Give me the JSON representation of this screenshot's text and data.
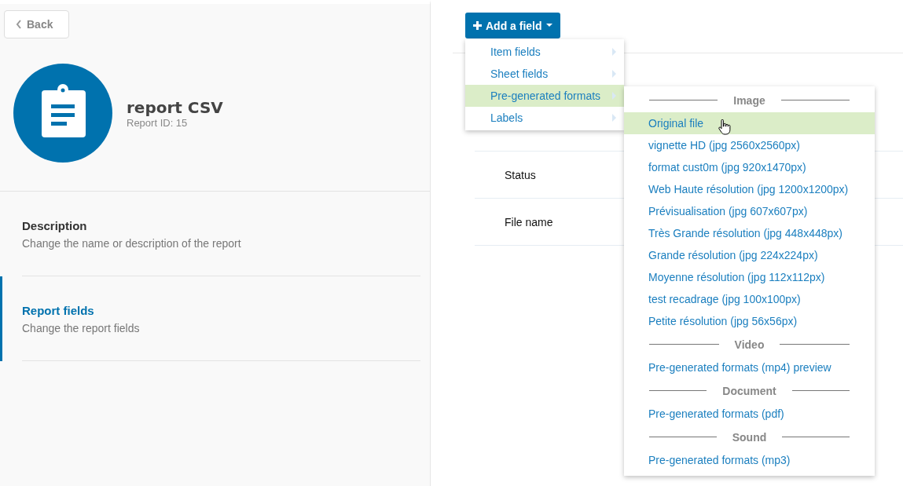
{
  "back_button": {
    "label": "Back"
  },
  "report": {
    "title": "report CSV",
    "subtitle": "Report ID: 15"
  },
  "sections": [
    {
      "title": "Description",
      "subtitle": "Change the name or description of the report",
      "selected": false
    },
    {
      "title": "Report fields",
      "subtitle": "Change the report fields",
      "selected": true
    }
  ],
  "add_field_button": {
    "label": "Add a field"
  },
  "field_rows": [
    {
      "label": "Status"
    },
    {
      "label": "File name"
    }
  ],
  "menu": [
    {
      "label": "Item fields",
      "selected": false
    },
    {
      "label": "Sheet fields",
      "selected": false
    },
    {
      "label": "Pre-generated formats",
      "selected": true
    },
    {
      "label": "Labels",
      "selected": false
    }
  ],
  "submenu": [
    {
      "kind": "header",
      "label": "Image"
    },
    {
      "kind": "item",
      "label": "Original file",
      "selected": true
    },
    {
      "kind": "item",
      "label": "vignette HD (jpg 2560x2560px)",
      "selected": false
    },
    {
      "kind": "item",
      "label": "format cust0m (jpg 920x1470px)",
      "selected": false
    },
    {
      "kind": "item",
      "label": "Web Haute résolution (jpg 1200x1200px)",
      "selected": false
    },
    {
      "kind": "item",
      "label": "Prévisualisation (jpg 607x607px)",
      "selected": false
    },
    {
      "kind": "item",
      "label": "Très Grande résolution (jpg 448x448px)",
      "selected": false
    },
    {
      "kind": "item",
      "label": "Grande résolution (jpg 224x224px)",
      "selected": false
    },
    {
      "kind": "item",
      "label": "Moyenne résolution (jpg 112x112px)",
      "selected": false
    },
    {
      "kind": "item",
      "label": "test recadrage (jpg 100x100px)",
      "selected": false
    },
    {
      "kind": "item",
      "label": "Petite résolution (jpg 56x56px)",
      "selected": false
    },
    {
      "kind": "header",
      "label": "Video"
    },
    {
      "kind": "item",
      "label": "Pre-generated formats (mp4) preview",
      "selected": false
    },
    {
      "kind": "header",
      "label": "Document"
    },
    {
      "kind": "item",
      "label": "Pre-generated formats (pdf)",
      "selected": false
    },
    {
      "kind": "header",
      "label": "Sound"
    },
    {
      "kind": "item",
      "label": "Pre-generated formats (mp3)",
      "selected": false
    }
  ]
}
